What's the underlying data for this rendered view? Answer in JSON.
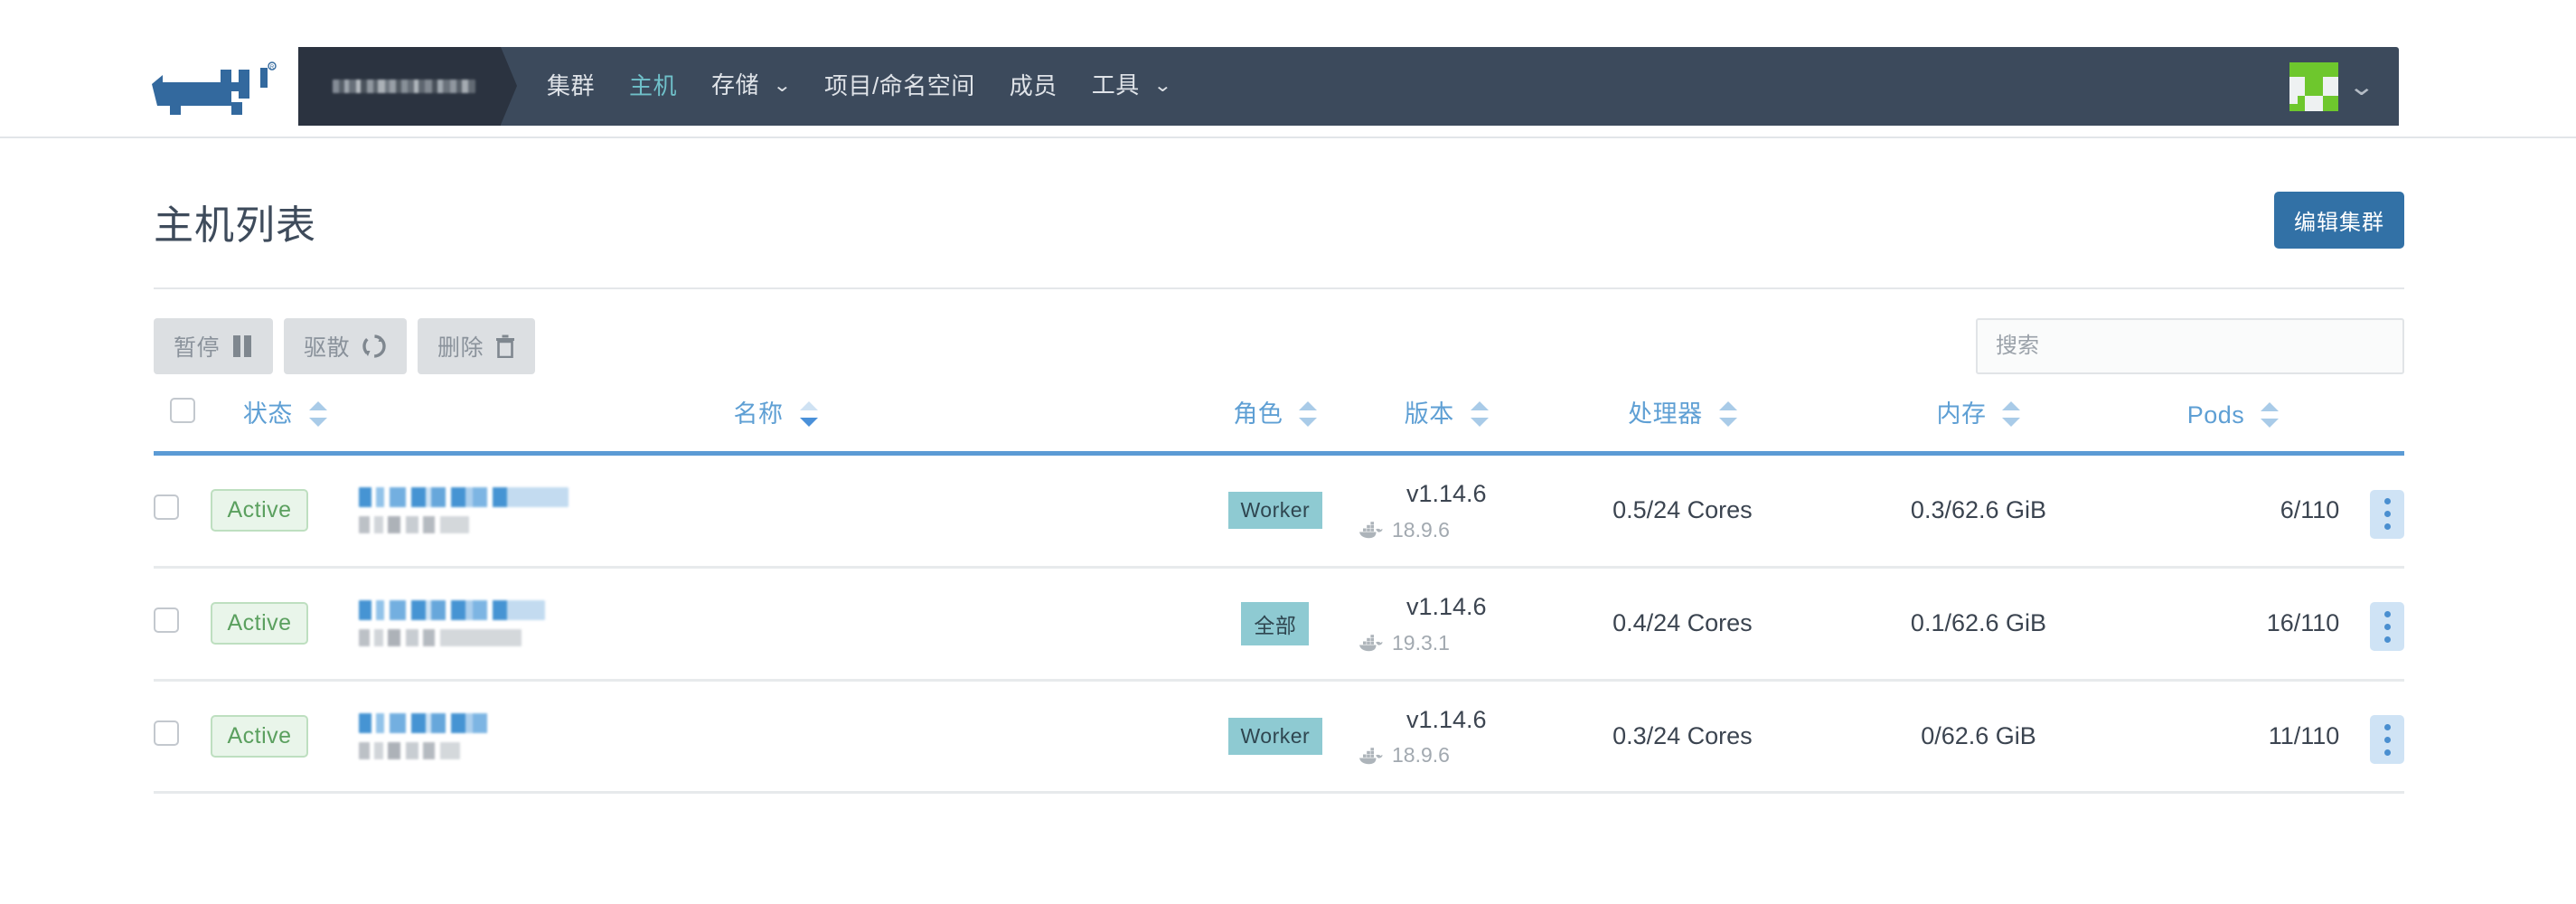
{
  "app": {
    "logo_name": "rancher-cow-logo",
    "breadcrumb_cluster": "████ ███ ▪",
    "nav_items": [
      {
        "label": "集群",
        "active": false,
        "caret": false
      },
      {
        "label": "主机",
        "active": true,
        "caret": false
      },
      {
        "label": "存储",
        "active": false,
        "caret": true
      },
      {
        "label": "项目/命名空间",
        "active": false,
        "caret": false
      },
      {
        "label": "成员",
        "active": false,
        "caret": false
      },
      {
        "label": "工具",
        "active": false,
        "caret": true
      }
    ],
    "caret_glyph": "⌄",
    "avatar_label": "user-avatar"
  },
  "header": {
    "title": "主机列表",
    "edit_cluster_label": "编辑集群"
  },
  "toolbar": {
    "pause_label": "暂停",
    "drain_label": "驱散",
    "delete_label": "删除",
    "search_placeholder": "搜索",
    "search_value": ""
  },
  "table": {
    "columns": [
      {
        "key": "state",
        "label": "状态",
        "sorted": false
      },
      {
        "key": "name",
        "label": "名称",
        "sorted": true
      },
      {
        "key": "role",
        "label": "角色",
        "sorted": false
      },
      {
        "key": "ver",
        "label": "版本",
        "sorted": false
      },
      {
        "key": "cpu",
        "label": "处理器",
        "sorted": false
      },
      {
        "key": "mem",
        "label": "内存",
        "sorted": false
      },
      {
        "key": "pods",
        "label": "Pods",
        "sorted": false
      }
    ],
    "rows": [
      {
        "state": "Active",
        "name_redacted": true,
        "role": "Worker",
        "version": "v1.14.6",
        "docker_version": "18.9.6",
        "cpu": "0.5/24 Cores",
        "memory": "0.3/62.6 GiB",
        "pods": "6/110"
      },
      {
        "state": "Active",
        "name_redacted": true,
        "role": "全部",
        "version": "v1.14.6",
        "docker_version": "19.3.1",
        "cpu": "0.4/24 Cores",
        "memory": "0.1/62.6 GiB",
        "pods": "16/110"
      },
      {
        "state": "Active",
        "name_redacted": true,
        "role": "Worker",
        "version": "v1.14.6",
        "docker_version": "18.9.6",
        "cpu": "0.3/24 Cores",
        "memory": "0/62.6 GiB",
        "pods": "11/110"
      }
    ]
  },
  "colors": {
    "nav_bg": "#3c4a5c",
    "breadcrumb_bg": "#2b3340",
    "nav_active": "#6fc0c9",
    "primary": "#3271a6",
    "link": "#3d8fd1",
    "header_text": "#5e9fd4",
    "header_rule": "#5b9bd5",
    "badge_active_bg": "#e9f5ea",
    "badge_active_text": "#5ba05f",
    "badge_role_bg": "#8ecad2",
    "avatar_green": "#6ec72d"
  }
}
